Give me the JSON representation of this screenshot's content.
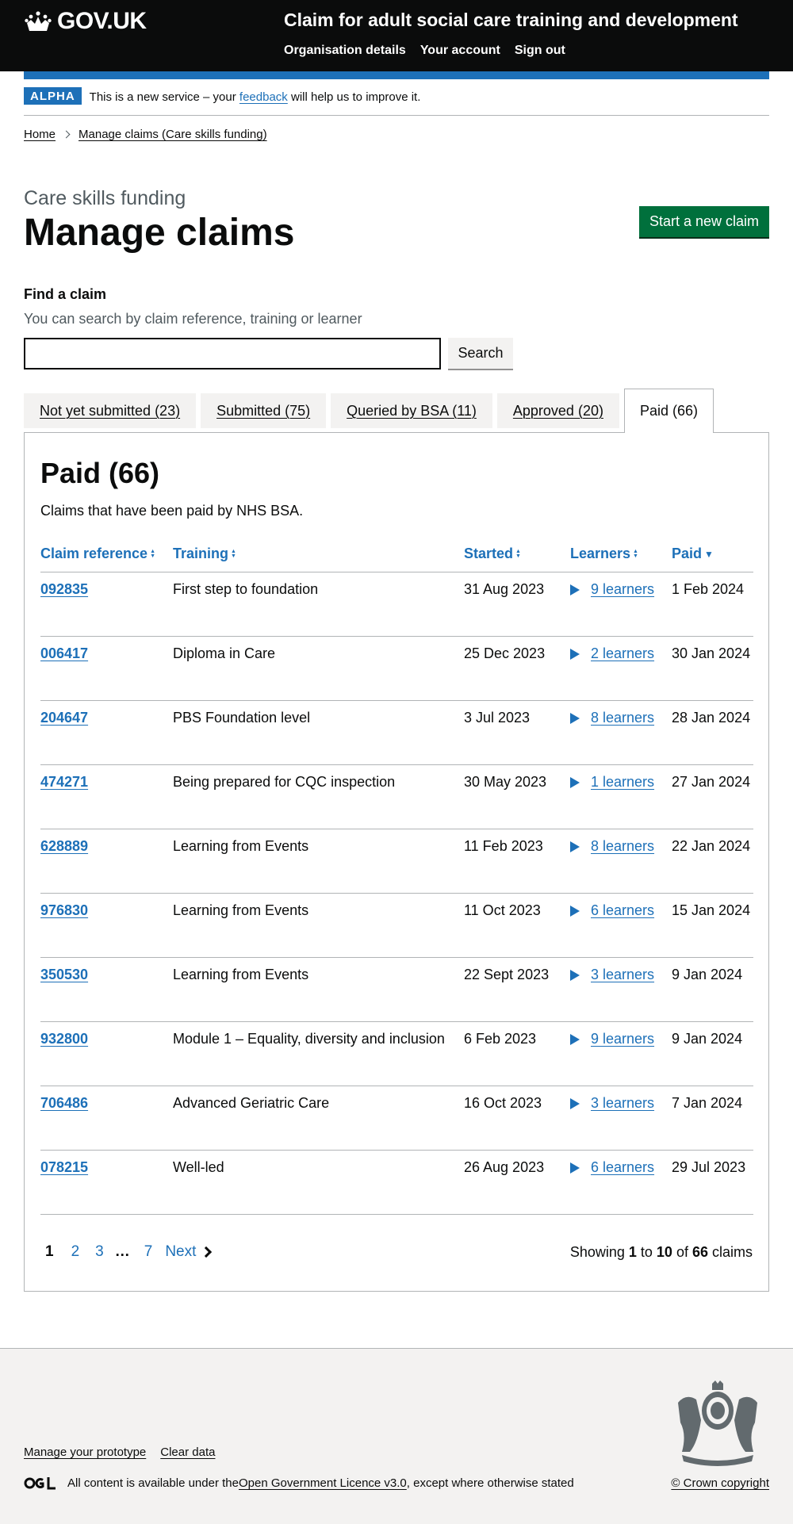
{
  "header": {
    "logo_text": "GOV.UK",
    "service_name": "Claim for adult social care training and development",
    "nav": [
      "Organisation details",
      "Your account",
      "Sign out"
    ]
  },
  "phase_banner": {
    "tag": "ALPHA",
    "text_before": "This is a new service – your ",
    "link": "feedback",
    "text_after": " will help us to improve it."
  },
  "breadcrumbs": [
    "Home",
    "Manage claims (Care skills funding)"
  ],
  "page": {
    "caption": "Care skills funding",
    "title": "Manage claims",
    "start_button": "Start a new claim"
  },
  "search": {
    "label": "Find a claim",
    "hint": "You can search by claim reference, training or learner",
    "value": "",
    "button": "Search"
  },
  "tabs": [
    {
      "label": "Not yet submitted (23)",
      "active": false
    },
    {
      "label": "Submitted (75)",
      "active": false
    },
    {
      "label": "Queried by BSA (11)",
      "active": false
    },
    {
      "label": "Approved (20)",
      "active": false
    },
    {
      "label": "Paid (66)",
      "active": true
    }
  ],
  "panel": {
    "title": "Paid (66)",
    "description": "Claims that have been paid by NHS BSA."
  },
  "table": {
    "headers": [
      "Claim reference",
      "Training",
      "Started",
      "Learners",
      "Paid"
    ],
    "rows": [
      {
        "ref": "092835",
        "training": "First step to foundation",
        "started": "31 Aug 2023",
        "learners": "9 learners",
        "paid": "1 Feb 2024"
      },
      {
        "ref": "006417",
        "training": "Diploma in Care",
        "started": "25 Dec 2023",
        "learners": "2 learners",
        "paid": "30 Jan 2024"
      },
      {
        "ref": "204647",
        "training": "PBS Foundation level",
        "started": "3 Jul 2023",
        "learners": "8 learners",
        "paid": "28 Jan 2024"
      },
      {
        "ref": "474271",
        "training": "Being prepared for CQC inspection",
        "started": "30 May 2023",
        "learners": "1 learners",
        "paid": "27 Jan 2024"
      },
      {
        "ref": "628889",
        "training": "Learning from Events",
        "started": "11 Feb 2023",
        "learners": "8 learners",
        "paid": "22 Jan 2024"
      },
      {
        "ref": "976830",
        "training": "Learning from Events",
        "started": "11 Oct 2023",
        "learners": "6 learners",
        "paid": "15 Jan 2024"
      },
      {
        "ref": "350530",
        "training": "Learning from Events",
        "started": "22 Sept 2023",
        "learners": "3 learners",
        "paid": "9 Jan 2024"
      },
      {
        "ref": "932800",
        "training": "Module 1 – Equality, diversity and inclusion",
        "started": "6 Feb 2023",
        "learners": "9 learners",
        "paid": "9 Jan 2024"
      },
      {
        "ref": "706486",
        "training": "Advanced Geriatric Care",
        "started": "16 Oct 2023",
        "learners": "3 learners",
        "paid": "7 Jan 2024"
      },
      {
        "ref": "078215",
        "training": "Well-led",
        "started": "26 Aug 2023",
        "learners": "6 learners",
        "paid": "29 Jul 2023"
      }
    ]
  },
  "pagination": {
    "current": "1",
    "pages": [
      "2",
      "3"
    ],
    "ellipsis": "…",
    "last": "7",
    "next": "Next",
    "showing_prefix": "Showing ",
    "from": "1",
    "to_word": " to ",
    "to": "10",
    "of_word": " of ",
    "total": "66",
    "suffix": " claims"
  },
  "footer": {
    "links": [
      "Manage your prototype",
      "Clear data"
    ],
    "licence_before": "All content is available under the ",
    "licence_link": "Open Government Licence v3.0",
    "licence_after": ", except where otherwise stated",
    "copyright": "© Crown copyright"
  },
  "colors": {
    "header_bg": "#0b0c0c",
    "brand_blue": "#1d70b8",
    "start_green": "#00703c",
    "footer_bg": "#f3f2f1"
  }
}
